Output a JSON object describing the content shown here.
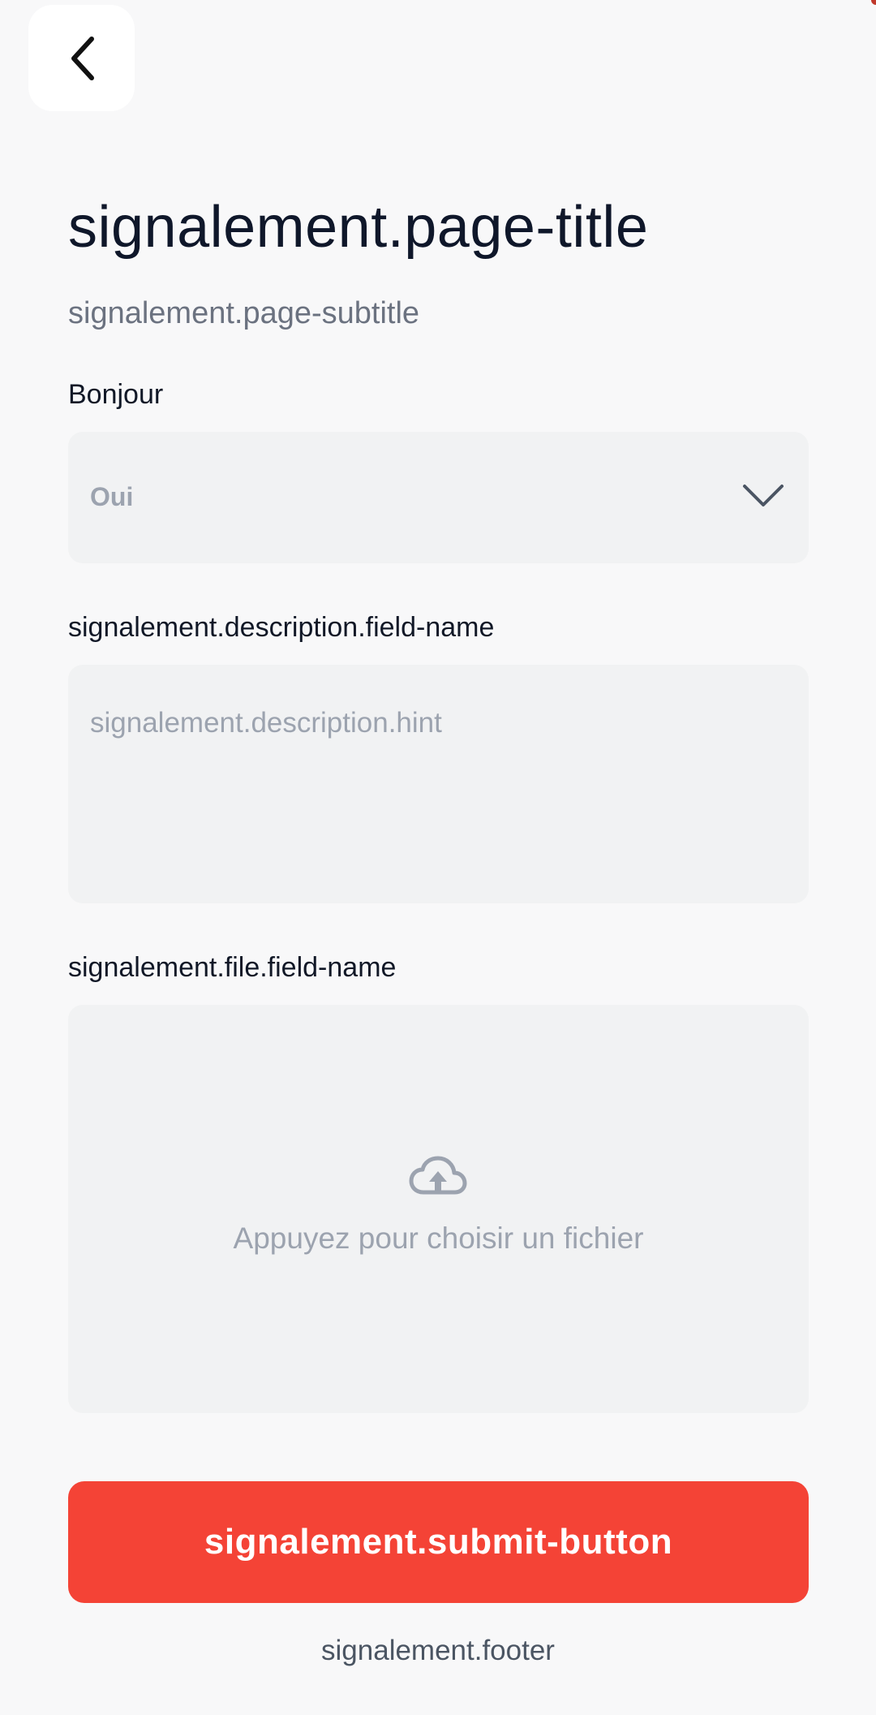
{
  "header": {
    "back_icon": "chevron-left-icon"
  },
  "page": {
    "title": "signalement.page-title",
    "subtitle": "signalement.page-subtitle"
  },
  "select_field": {
    "label": "Bonjour",
    "value": "Oui",
    "icon": "chevron-down-icon"
  },
  "description_field": {
    "label": "signalement.description.field-name",
    "placeholder": "signalement.description.hint"
  },
  "file_field": {
    "label": "signalement.file.field-name",
    "prompt": "Appuyez pour choisir un fichier",
    "icon": "cloud-upload-icon"
  },
  "submit": {
    "label": "signalement.submit-button"
  },
  "footer": {
    "text": "signalement.footer"
  },
  "colors": {
    "background": "#f8f8f9",
    "field_background": "#f1f2f3",
    "accent": "#f44336",
    "title": "#0f172a",
    "placeholder": "#9ca3af"
  }
}
